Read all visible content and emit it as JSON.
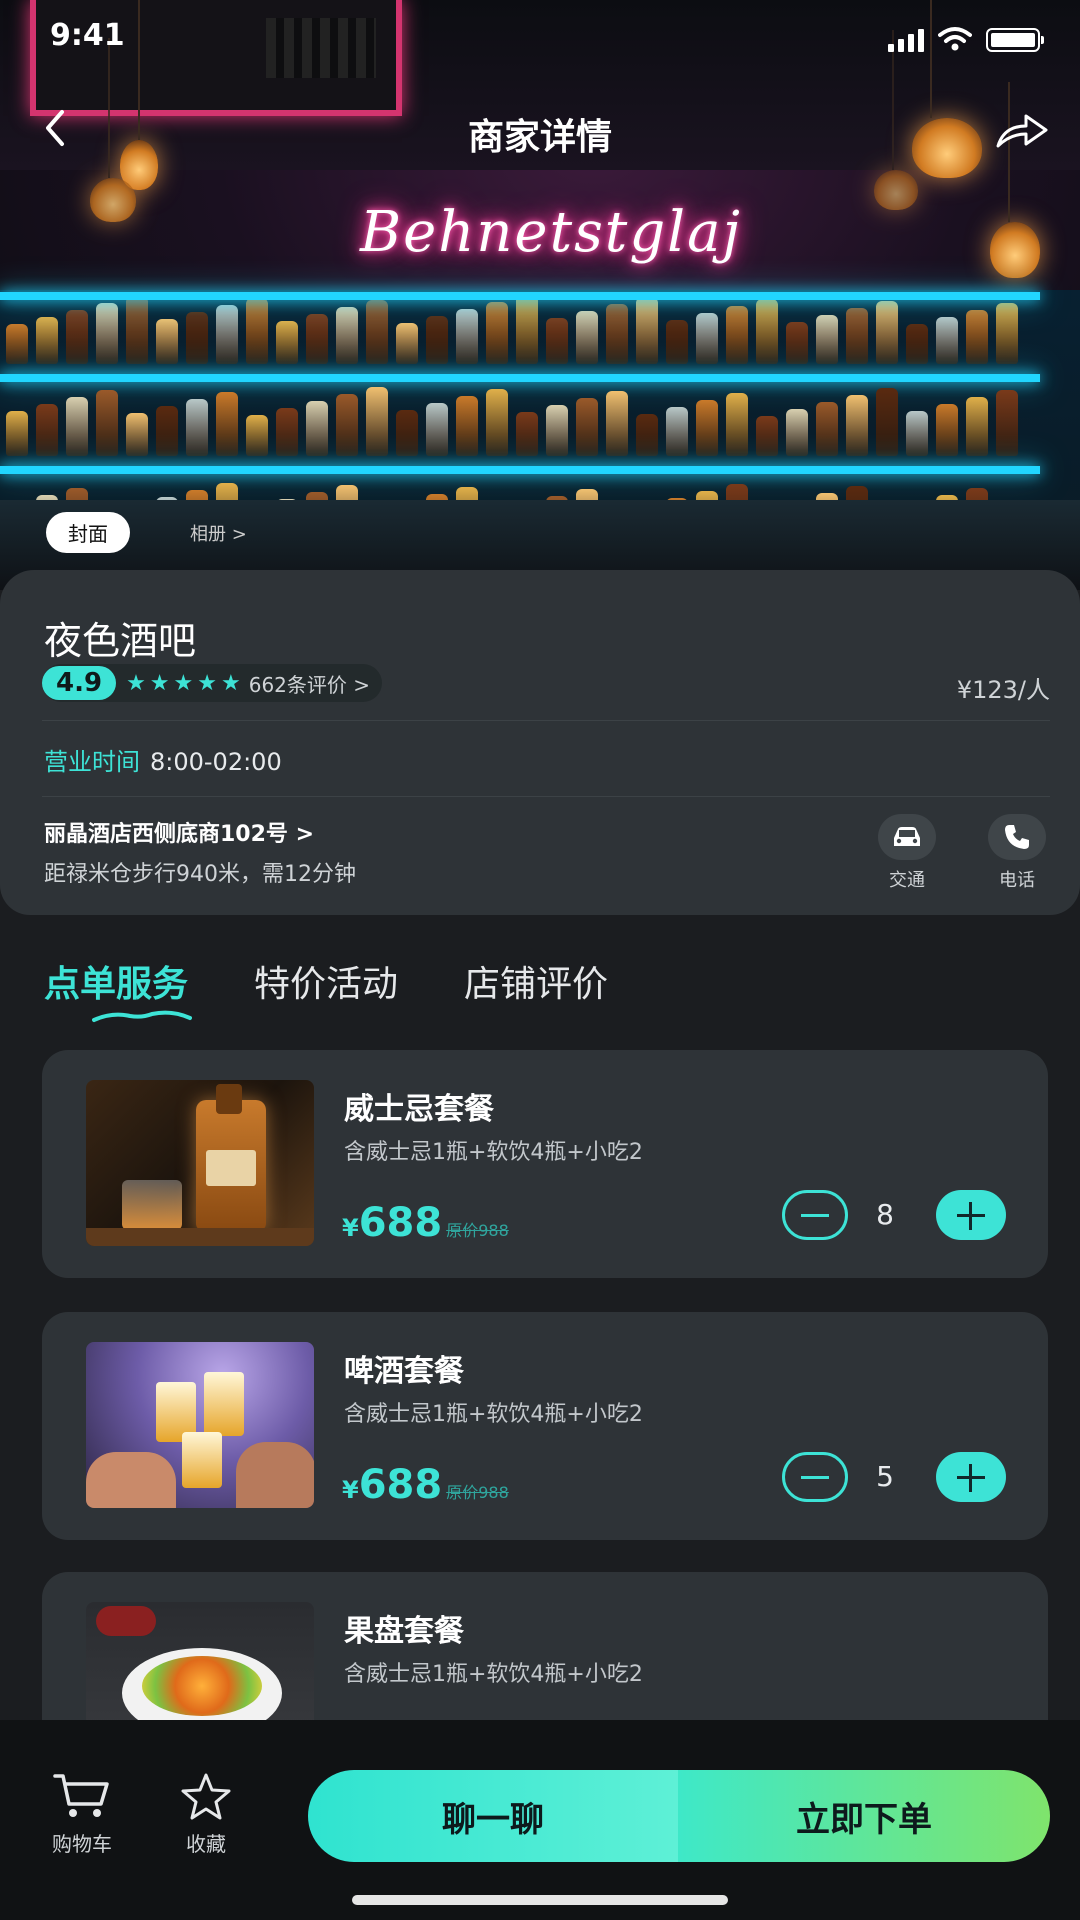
{
  "status_bar": {
    "time": "9:41"
  },
  "nav": {
    "title": "商家详情"
  },
  "gallery": {
    "cover_label": "封面",
    "album_label": "相册 >",
    "neon_sign": "Behnetstglaj"
  },
  "shop": {
    "name": "夜色酒吧",
    "score": "4.9",
    "reviews": "662条评价 >",
    "price_per_person": "¥123/人",
    "hours_label": "营业时间",
    "hours_value": "8:00-02:00",
    "address": "丽晶酒店西侧底商102号 >",
    "distance": "距禄米仓步行940米，需12分钟",
    "actions": [
      {
        "label": "交通",
        "icon": "car-icon"
      },
      {
        "label": "电话",
        "icon": "phone-icon"
      }
    ]
  },
  "tabs": [
    {
      "label": "点单服务",
      "active": true
    },
    {
      "label": "特价活动"
    },
    {
      "label": "店铺评价"
    }
  ],
  "packages": [
    {
      "title": "威士忌套餐",
      "desc": "含威士忌1瓶+软饮4瓶+小吃2",
      "currency": "¥",
      "price": "688",
      "original": "原价988",
      "qty": "8"
    },
    {
      "title": "啤酒套餐",
      "desc": "含威士忌1瓶+软饮4瓶+小吃2",
      "currency": "¥",
      "price": "688",
      "original": "原价988",
      "qty": "5"
    },
    {
      "title": "果盘套餐",
      "desc": "含威士忌1瓶+软饮4瓶+小吃2"
    }
  ],
  "bottom_bar": {
    "cart_label": "购物车",
    "fav_label": "收藏",
    "chat_label": "聊一聊",
    "order_label": "立即下单"
  },
  "colors": {
    "accent": "#3de3d6",
    "card_bg": "#2e3337",
    "page_bg": "#1b1d20"
  }
}
